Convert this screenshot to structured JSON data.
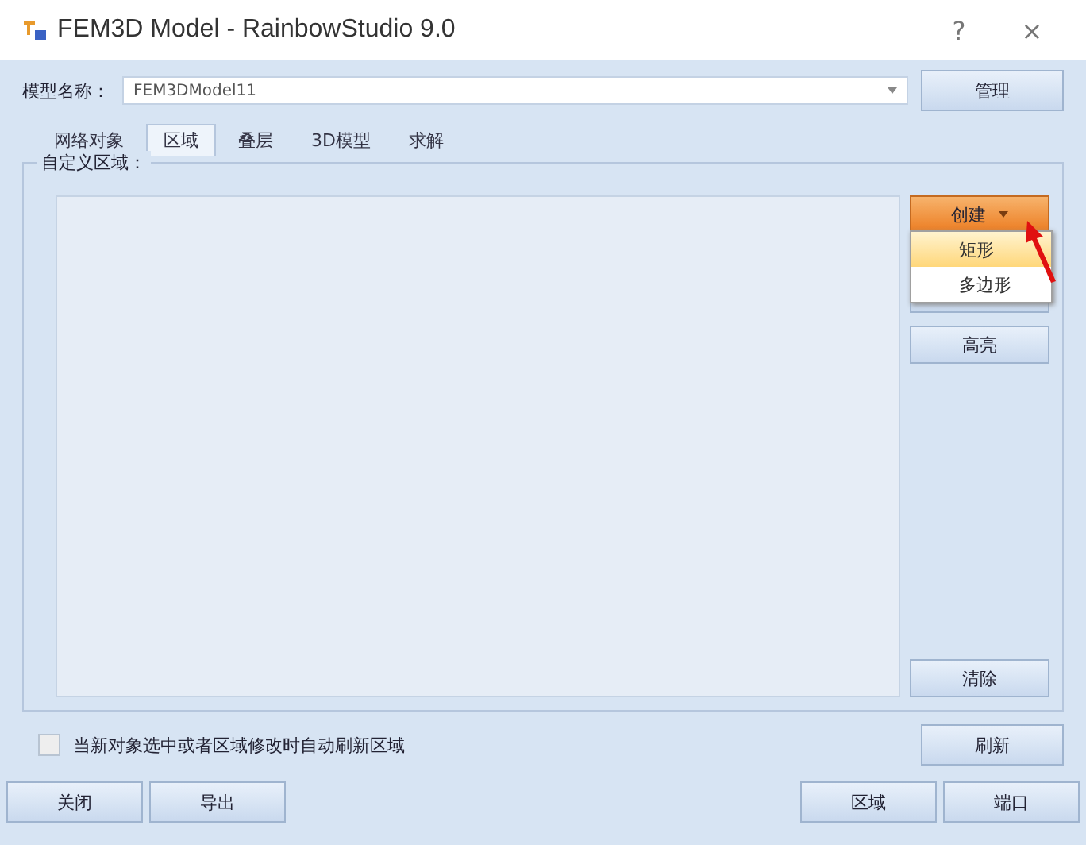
{
  "window": {
    "title": "FEM3D Model - RainbowStudio 9.0",
    "help": "?",
    "close": "×"
  },
  "model": {
    "label": "模型名称：",
    "value": "FEM3DModel11",
    "manage": "管理"
  },
  "tabs": [
    {
      "label": "网络对象",
      "selected": false
    },
    {
      "label": "区域",
      "selected": true
    },
    {
      "label": "叠层",
      "selected": false
    },
    {
      "label": "3D模型",
      "selected": false
    },
    {
      "label": "求解",
      "selected": false
    }
  ],
  "group": {
    "title": "自定义区域："
  },
  "create_button": {
    "label": "创建",
    "open": true
  },
  "create_menu": [
    {
      "label": "矩形",
      "selected": true
    },
    {
      "label": "多边形",
      "selected": false
    }
  ],
  "side_buttons": [
    {
      "label": "高亮"
    },
    {
      "label": "清除"
    }
  ],
  "auto_refresh": {
    "label": "当新对象选中或者区域修改时自动刷新区域",
    "checked": false
  },
  "refresh": "刷新",
  "bottom_left": [
    "关闭",
    "导出"
  ],
  "bottom_right": [
    "区域",
    "端口"
  ]
}
